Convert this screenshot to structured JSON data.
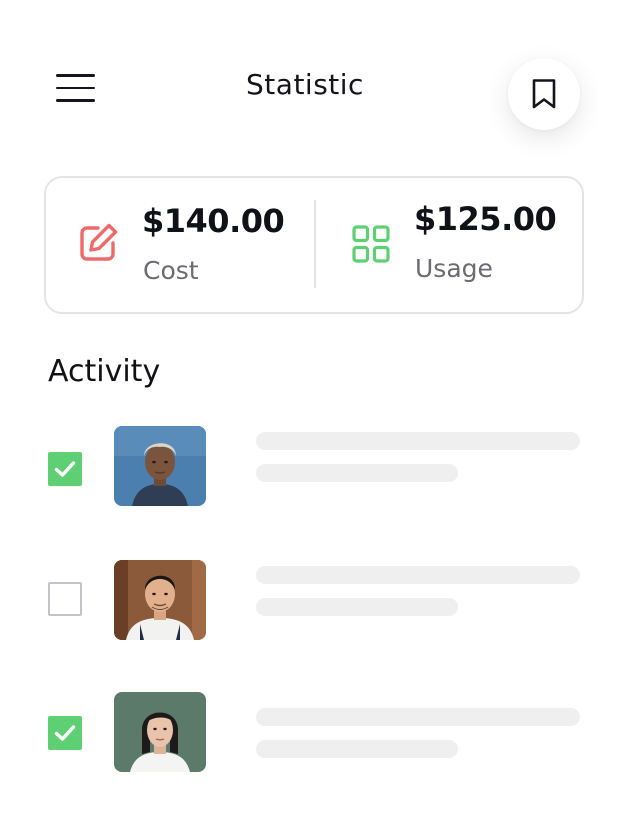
{
  "header": {
    "title": "Statistic",
    "menu_icon": "hamburger-menu-icon",
    "bookmark_icon": "bookmark-icon"
  },
  "stats": [
    {
      "value": "$140.00",
      "label": "Cost",
      "icon": "edit-icon",
      "color": "#ee6a6a"
    },
    {
      "value": "$125.00",
      "label": "Usage",
      "icon": "grid-icon",
      "color": "#5fcf74"
    }
  ],
  "activity": {
    "title": "Activity",
    "items": [
      {
        "checked": true,
        "avatar": "avatar-woman-short-blonde-hair",
        "bg": "#4a7fb0"
      },
      {
        "checked": false,
        "avatar": "avatar-man-apron",
        "bg": "#8a5a3a"
      },
      {
        "checked": true,
        "avatar": "avatar-woman-dark-hair",
        "bg": "#5c7a6a"
      }
    ]
  },
  "colors": {
    "accent_green": "#5fcf74",
    "accent_red": "#ee6a6a",
    "skeleton": "#efefef"
  }
}
